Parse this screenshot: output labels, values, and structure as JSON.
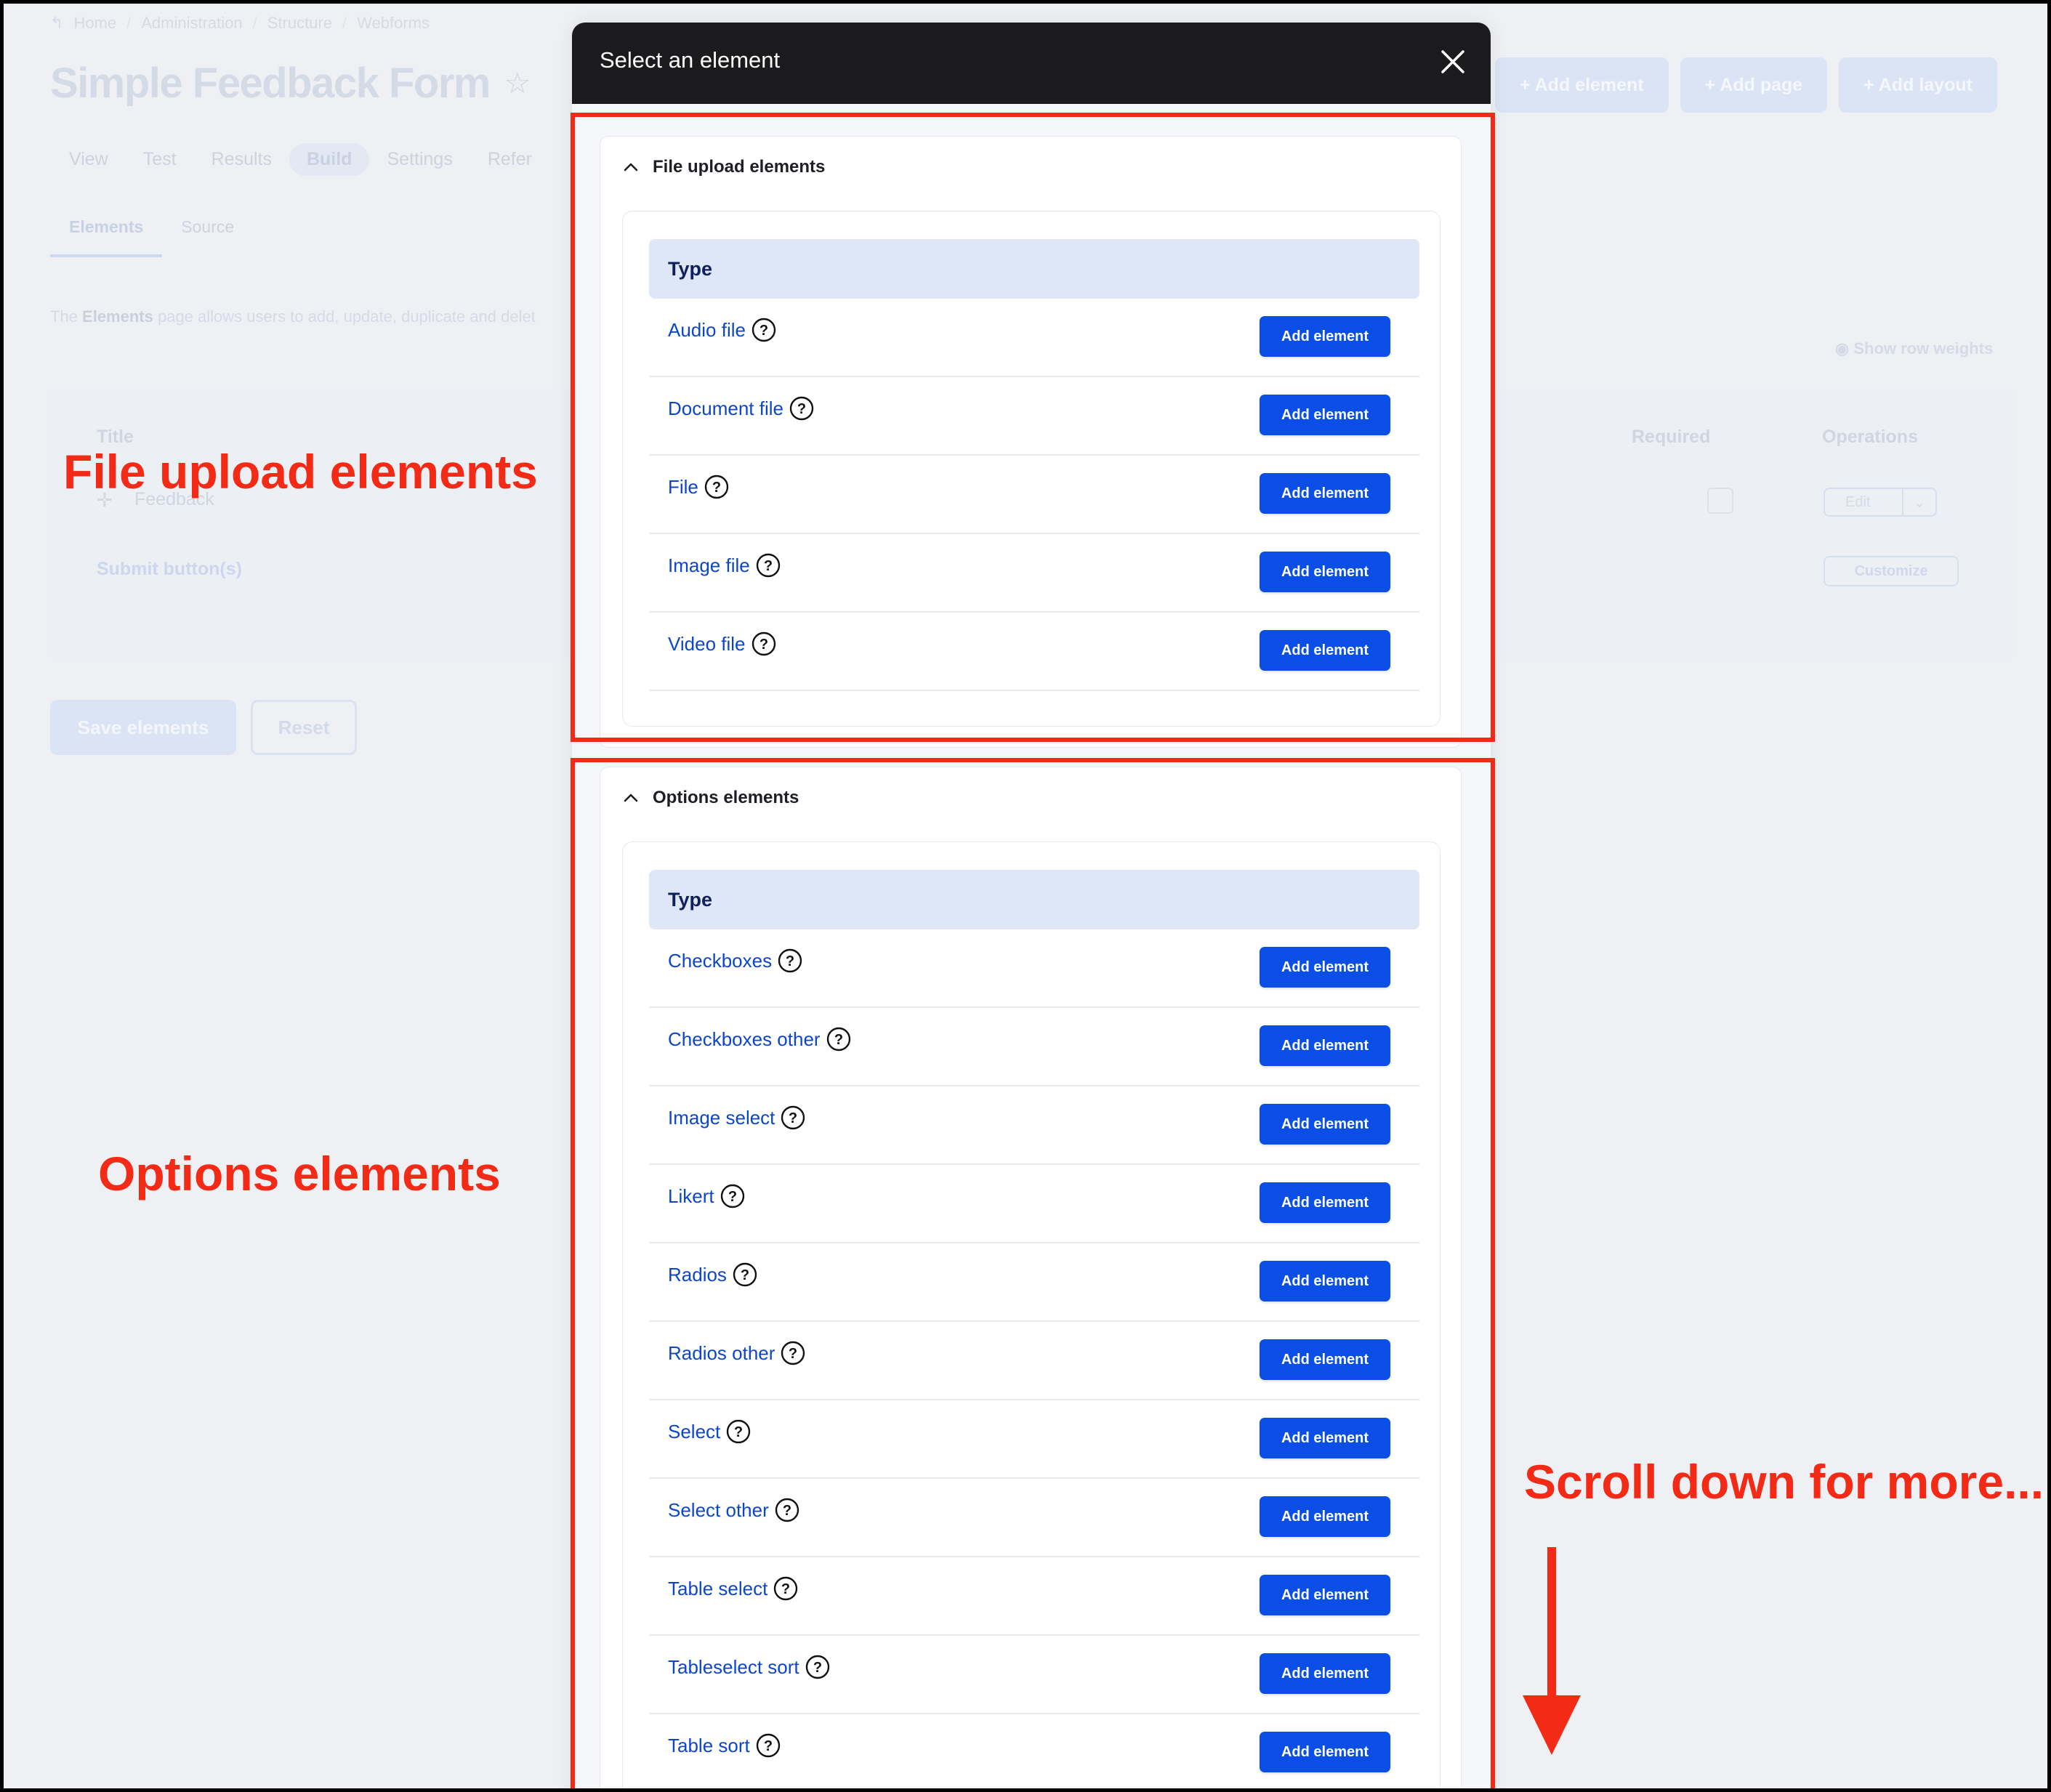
{
  "background": {
    "breadcrumb": [
      "Home",
      "Administration",
      "Structure",
      "Webforms"
    ],
    "page_title": "Simple Feedback Form",
    "tabs": [
      "View",
      "Test",
      "Results",
      "Build",
      "Settings",
      "Refer"
    ],
    "active_tab": "Build",
    "subtabs": [
      "Elements",
      "Source"
    ],
    "description_prefix": "The ",
    "description_bold": "Elements",
    "description_suffix": " page allows users to add, update, duplicate and delet",
    "top_buttons": [
      "+ Add element",
      "+ Add page",
      "+ Add layout"
    ],
    "show_row_weights": "Show row weights",
    "table_headers": {
      "title": "Title",
      "required": "Required",
      "operations": "Operations"
    },
    "rows": {
      "feedback": "Feedback",
      "submit": "Submit button(s)"
    },
    "edit_label": "Edit",
    "customize_label": "Customize",
    "save_label": "Save elements",
    "reset_label": "Reset"
  },
  "modal": {
    "title": "Select an element",
    "sections": [
      {
        "title": "File upload elements",
        "column_header": "Type",
        "items": [
          "Audio file",
          "Document file",
          "File",
          "Image file",
          "Video file"
        ]
      },
      {
        "title": "Options elements",
        "column_header": "Type",
        "items": [
          "Checkboxes",
          "Checkboxes other",
          "Image select",
          "Likert",
          "Radios",
          "Radios other",
          "Select",
          "Select other",
          "Table select",
          "Tableselect sort",
          "Table sort"
        ]
      }
    ],
    "add_button_label": "Add element"
  },
  "annotations": {
    "file_upload": "File upload elements",
    "options": "Options elements",
    "scroll": "Scroll down for more..."
  },
  "colors": {
    "annotation_red": "#f22a16",
    "button_blue": "#0a4ee6",
    "link_blue": "#0c46c9",
    "modal_header": "#1b1b1d"
  }
}
